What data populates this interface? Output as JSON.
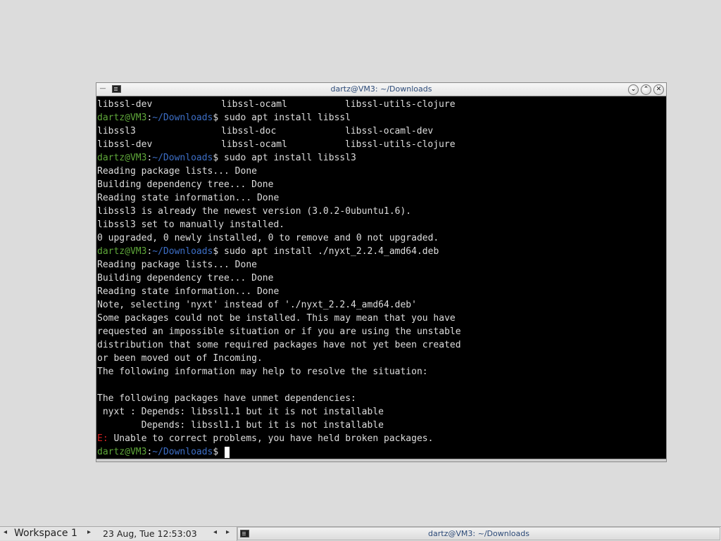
{
  "window": {
    "title": "dartz@VM3: ~/Downloads",
    "menu_icon": "menu-icon",
    "terminal_icon": "terminal-icon",
    "buttons": [
      {
        "name": "minimize-icon",
        "glyph": "⌄"
      },
      {
        "name": "maximize-icon",
        "glyph": "⌃"
      },
      {
        "name": "close-icon",
        "glyph": "✕"
      }
    ]
  },
  "prompt": {
    "user": "dartz@VM3",
    "sep": ":",
    "path": "~/Downloads",
    "symbol": "$ "
  },
  "terminal_lines": [
    {
      "type": "cols",
      "cols": [
        "libssl-dev",
        "libssl-ocaml",
        "libssl-utils-clojure"
      ]
    },
    {
      "type": "prompt",
      "cmd": "sudo apt install libssl"
    },
    {
      "type": "cols",
      "cols": [
        "libssl3",
        "libssl-doc",
        "libssl-ocaml-dev"
      ]
    },
    {
      "type": "cols",
      "cols": [
        "libssl-dev",
        "libssl-ocaml",
        "libssl-utils-clojure"
      ]
    },
    {
      "type": "prompt",
      "cmd": "sudo apt install libssl3"
    },
    {
      "type": "text",
      "text": "Reading package lists... Done"
    },
    {
      "type": "text",
      "text": "Building dependency tree... Done"
    },
    {
      "type": "text",
      "text": "Reading state information... Done"
    },
    {
      "type": "text",
      "text": "libssl3 is already the newest version (3.0.2-0ubuntu1.6)."
    },
    {
      "type": "text",
      "text": "libssl3 set to manually installed."
    },
    {
      "type": "text",
      "text": "0 upgraded, 0 newly installed, 0 to remove and 0 not upgraded."
    },
    {
      "type": "prompt",
      "cmd": "sudo apt install ./nyxt_2.2.4_amd64.deb"
    },
    {
      "type": "text",
      "text": "Reading package lists... Done"
    },
    {
      "type": "text",
      "text": "Building dependency tree... Done"
    },
    {
      "type": "text",
      "text": "Reading state information... Done"
    },
    {
      "type": "text",
      "text": "Note, selecting 'nyxt' instead of './nyxt_2.2.4_amd64.deb'"
    },
    {
      "type": "text",
      "text": "Some packages could not be installed. This may mean that you have"
    },
    {
      "type": "text",
      "text": "requested an impossible situation or if you are using the unstable"
    },
    {
      "type": "text",
      "text": "distribution that some required packages have not yet been created"
    },
    {
      "type": "text",
      "text": "or been moved out of Incoming."
    },
    {
      "type": "text",
      "text": "The following information may help to resolve the situation:"
    },
    {
      "type": "text",
      "text": ""
    },
    {
      "type": "text",
      "text": "The following packages have unmet dependencies:"
    },
    {
      "type": "text",
      "text": " nyxt : Depends: libssl1.1 but it is not installable"
    },
    {
      "type": "text",
      "text": "        Depends: libssl1.1 but it is not installable"
    },
    {
      "type": "error",
      "label": "E:",
      "text": " Unable to correct problems, you have held broken packages."
    },
    {
      "type": "prompt",
      "cmd": "",
      "cursor": true
    }
  ],
  "taskbar": {
    "workspace": "Workspace 1",
    "clock": "23 Aug, Tue 12:53:03",
    "task_label": "dartz@VM3: ~/Downloads",
    "arrow_left": "◂",
    "arrow_right": "▸"
  },
  "colors": {
    "prompt_user": "#5fa83a",
    "prompt_path": "#3d6fc7",
    "error": "#d02020",
    "terminal_bg": "#000000",
    "desktop_bg": "#dcdcdc"
  }
}
